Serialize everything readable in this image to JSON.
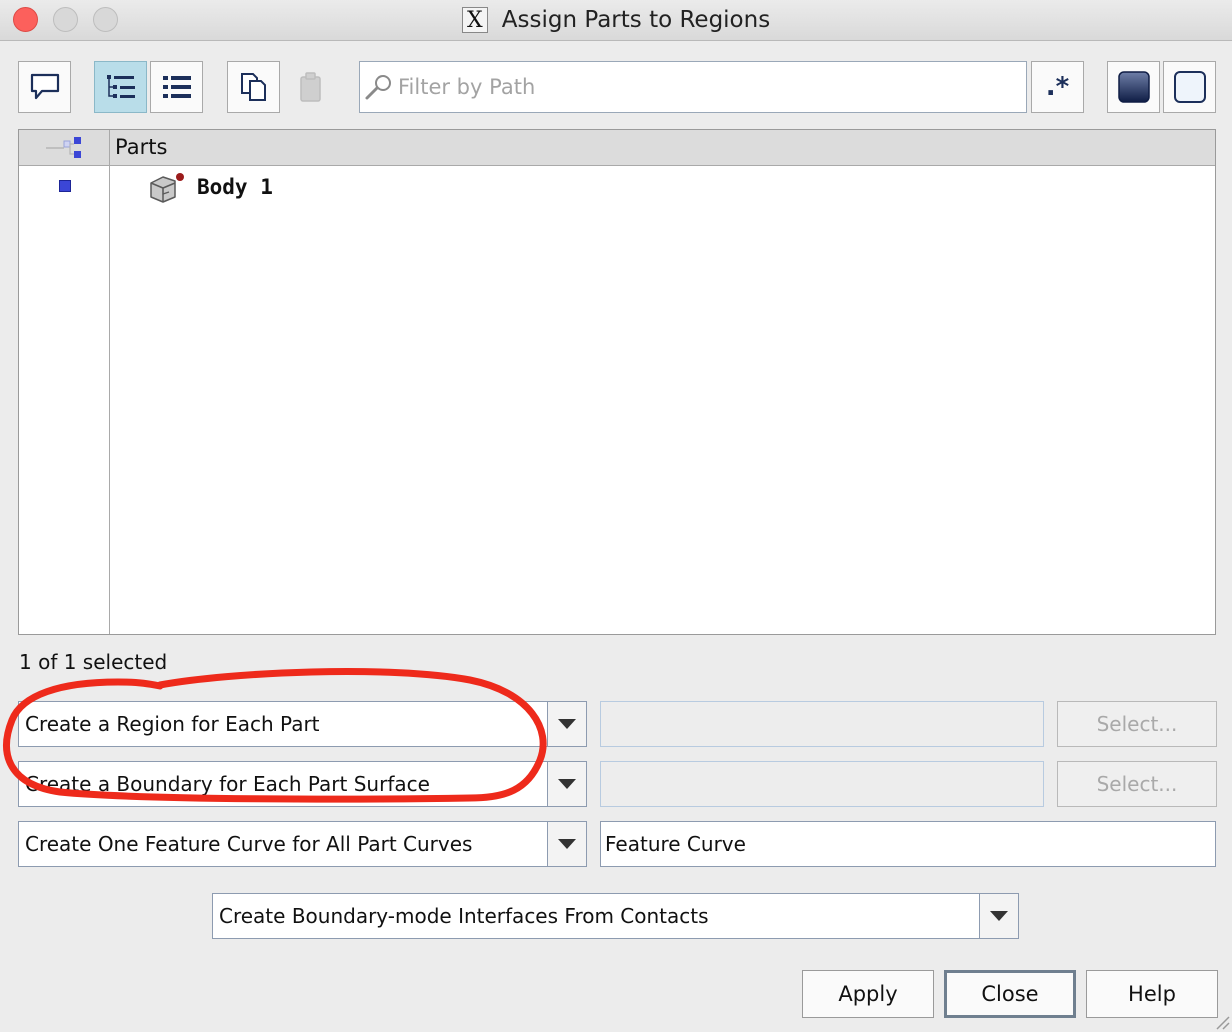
{
  "window": {
    "title": "Assign Parts to Regions",
    "app_glyph": "X"
  },
  "toolbar": {
    "filter_placeholder": "Filter by Path",
    "regex_label": ".*"
  },
  "table": {
    "header": "Parts",
    "rows": [
      {
        "label": "Body 1",
        "selected": true
      }
    ]
  },
  "status": "1 of 1 selected",
  "options": {
    "region_mode": "Create a Region for Each Part",
    "boundary_mode": "Create a Boundary for Each Part Surface",
    "feature_mode": "Create One Feature Curve for All Part Curves",
    "feature_name": "Feature Curve",
    "interface_mode": "Create Boundary-mode Interfaces From Contacts",
    "select_label": "Select..."
  },
  "buttons": {
    "apply": "Apply",
    "close": "Close",
    "help": "Help"
  },
  "colors": {
    "accent_active": "#b9dde9",
    "annotation": "#ee2a1b",
    "selection_marker": "#3b46d6"
  }
}
